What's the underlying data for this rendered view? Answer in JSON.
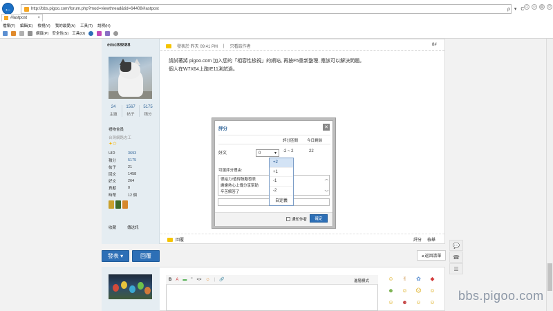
{
  "browser": {
    "url": "http://bbs.pigoo.com/forum.php?mod=viewthread&tid=64408#lastpost",
    "tab_title": "#lastpost",
    "nav_icons": [
      "back-icon",
      "forward-icon"
    ],
    "menu": [
      "檔案(F)",
      "編輯(E)",
      "檢視(V)",
      "我的最愛(A)",
      "工具(T)",
      "說明(H)"
    ],
    "commands": [
      "網頁(P)",
      "安全性(S)",
      "工具(O)"
    ],
    "address_tools": "ρ ▾ C",
    "window_tools": [
      "⌂",
      "☆",
      "⚙",
      "☺"
    ]
  },
  "author": {
    "name": "emc88888",
    "stats": [
      {
        "value": "24",
        "label": "主題"
      },
      {
        "value": "1567",
        "label": "帖子"
      },
      {
        "value": "5175",
        "label": "積分"
      }
    ],
    "rank": "禮物會員",
    "group": "台灣網路志工",
    "stars": "✦✩",
    "profile": [
      {
        "key": "UID",
        "value": "3693",
        "link": true
      },
      {
        "key": "積分",
        "value": "5175",
        "link": true
      },
      {
        "key": "帖子",
        "value": "21",
        "link": false
      },
      {
        "key": "回文",
        "value": "1458",
        "link": false
      },
      {
        "key": "好文",
        "value": "264",
        "link": false
      },
      {
        "key": "貢獻",
        "value": "0",
        "link": false
      },
      {
        "key": "時幣",
        "value": "12 個",
        "link": false
      }
    ],
    "actions": [
      "收藏",
      "傳送訊"
    ]
  },
  "post": {
    "meta": "發表於 昨天 09:41 PM",
    "only_author": "只看該作者",
    "floor": "8#",
    "body_line1": "請試著將 pigoo.com 加入您的「相容性檢視」的網站, 再按F5重新整理, 應該可以解決問題。",
    "body_line2": "個人在W7X64上跑IE11測試過。",
    "reply": "回覆",
    "rate": "評分",
    "report": "檢舉"
  },
  "actions": {
    "post_btn": "發表 ▾",
    "reply_btn": "回覆",
    "back_list": "◂ 返回清單"
  },
  "editor": {
    "tools": [
      "B",
      "A",
      "▬",
      "\"",
      "<>",
      "☺",
      "|",
      "🔗"
    ],
    "mode": "進階模式"
  },
  "smileys": [
    "☺",
    "✌",
    "✿",
    "◆",
    "☻",
    "☺",
    "☹",
    "☺",
    "☺",
    "☻",
    "☺",
    "☺"
  ],
  "float_tools": [
    "💬",
    "☎",
    "☰"
  ],
  "watermark": "bbs.pigoo.com",
  "dialog": {
    "title": "評分",
    "close": "✕",
    "col_range": "評分區間",
    "col_today": "今日剩餘",
    "row_label": "好文",
    "selected": "0",
    "range": "-2 ~ 2",
    "today": "22",
    "reason_label": "可選評分理由:",
    "reasons": [
      "很給力!值得鼓勵發表",
      "謝謝熱心上傳分享幫助",
      "辛苦解答了"
    ],
    "options": [
      "+2",
      "+1",
      "-1",
      "-2",
      "自定義"
    ],
    "notify": "通知作者",
    "confirm": "確定"
  },
  "colors": {
    "accent": "#2d6fb6",
    "author_bg": "#e5edf2",
    "link": "#336699"
  }
}
